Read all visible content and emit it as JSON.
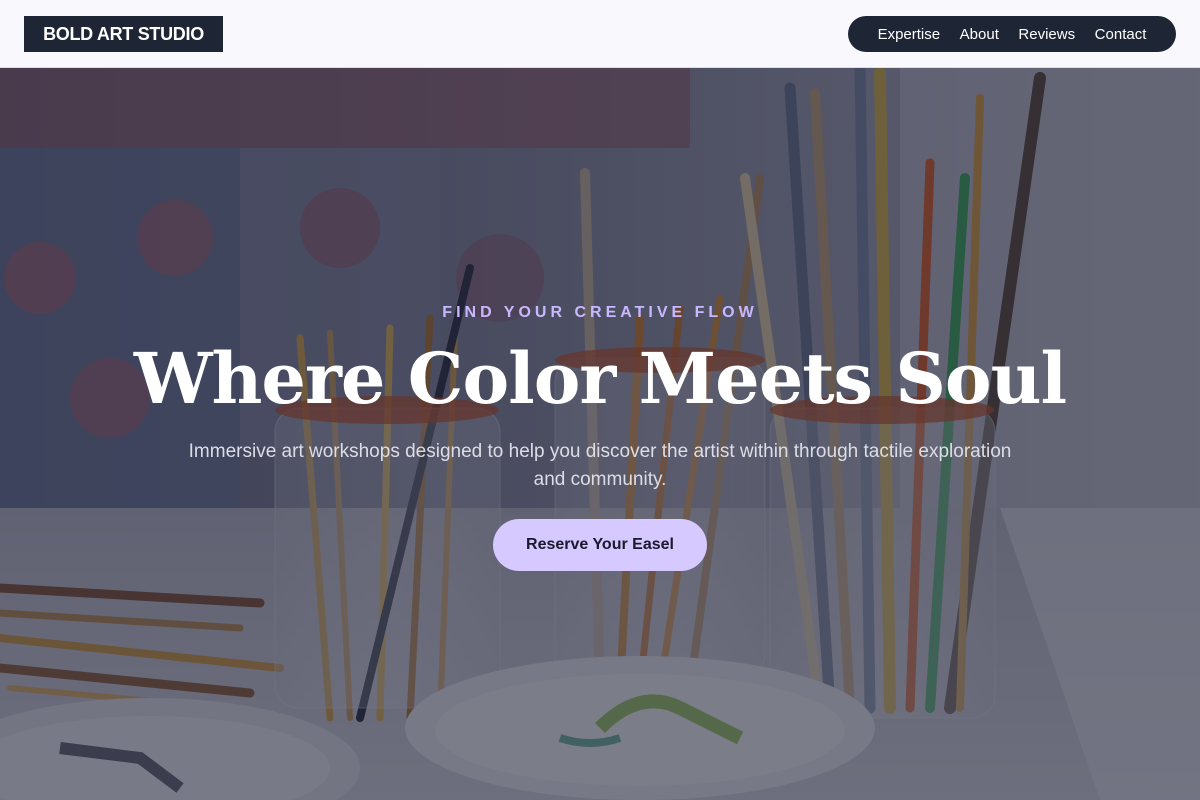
{
  "header": {
    "logo_text": "BOLD ART STUDIO",
    "nav": [
      {
        "label": "Expertise"
      },
      {
        "label": "About"
      },
      {
        "label": "Reviews"
      },
      {
        "label": "Contact"
      }
    ]
  },
  "hero": {
    "eyebrow": "FIND YOUR CREATIVE FLOW",
    "title": "Where Color Meets Soul",
    "subtitle": "Immersive art workshops designed to help you discover the artist within through tactile exploration and community.",
    "cta_label": "Reserve Your Easel",
    "background_image": "paintbrushes-in-glass-jars-photo"
  },
  "colors": {
    "header_bg": "#f9f9fd",
    "dark_navy": "#1e2535",
    "accent_lavender": "#c9b8ff",
    "cta_bg": "#d6c9ff"
  }
}
